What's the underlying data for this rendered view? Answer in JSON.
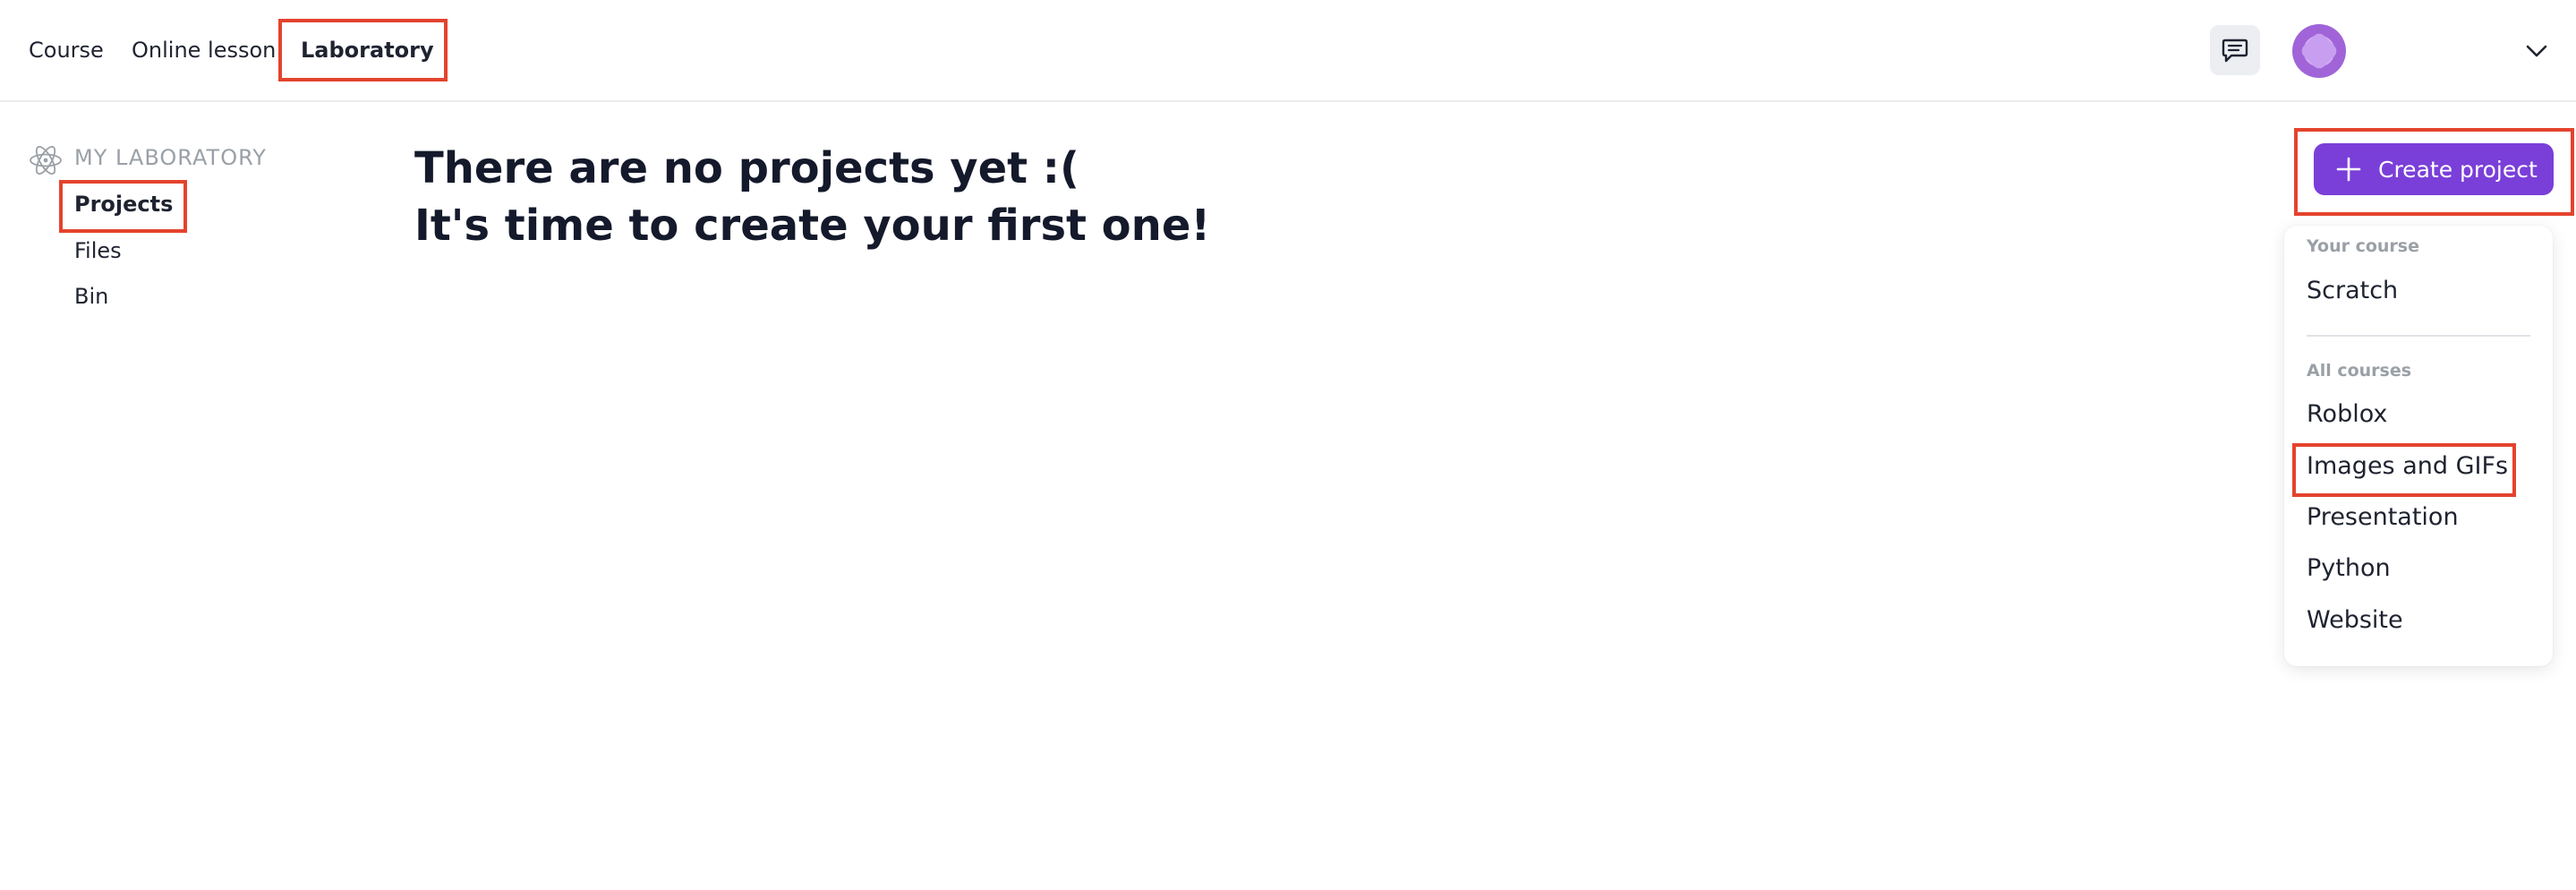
{
  "nav": {
    "tabs": [
      {
        "label": "Course"
      },
      {
        "label": "Online lesson"
      },
      {
        "label": "Laboratory",
        "active": true
      }
    ]
  },
  "header": {
    "chat_icon": "chat-bubble-icon",
    "profile_chevron_icon": "chevron-down-icon"
  },
  "sidebar": {
    "section_icon": "atom-icon",
    "title": "MY LABORATORY",
    "items": [
      {
        "label": "Projects",
        "active": true
      },
      {
        "label": "Files"
      },
      {
        "label": "Bin"
      }
    ]
  },
  "main": {
    "empty_line1": "There are no projects yet :(",
    "empty_line2": "It's time to create your first one!"
  },
  "create_button": {
    "label": "Create project",
    "icon": "plus-icon"
  },
  "dropdown": {
    "your_course_label": "Your course",
    "your_course_items": [
      "Scratch"
    ],
    "all_courses_label": "All courses",
    "all_courses_items": [
      "Roblox",
      "Images and GIFs",
      "Presentation",
      "Python",
      "Website"
    ]
  },
  "colors": {
    "accent": "#7a3fd8",
    "highlight": "#e4432d",
    "text": "#141a2b",
    "muted": "#9aa0a6"
  }
}
